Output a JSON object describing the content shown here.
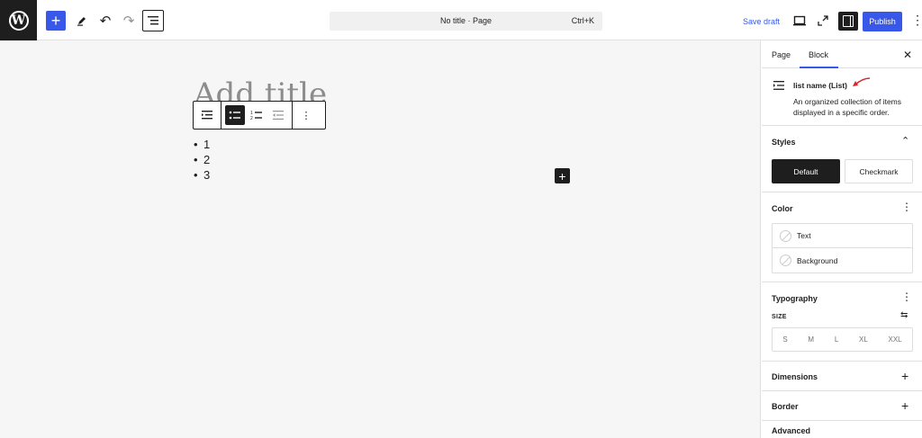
{
  "topbar": {
    "logo_letter": "W",
    "add_icon": "plus-icon",
    "tools_icon": "pencil-icon",
    "undo_icon": "undo-icon",
    "redo_icon": "redo-icon",
    "docview_icon": "list-view-icon",
    "command_title": "No title · Page",
    "command_shortcut": "Ctrl+K",
    "save_draft": "Save draft",
    "preview_icon": "desktop-icon",
    "external_icon": "external-link-icon",
    "settings_icon": "sidebar-toggle-icon",
    "publish": "Publish",
    "more_icon": "kebab-menu-icon"
  },
  "canvas": {
    "title_placeholder": "Add title",
    "list_items": [
      "1",
      "2",
      "3"
    ],
    "inserter_icon": "plus-icon"
  },
  "block_toolbar": {
    "icons": [
      "list-icon",
      "unordered-list-icon",
      "ordered-list-icon",
      "outdent-icon",
      "more-options-icon"
    ],
    "active": "unordered-list-icon"
  },
  "sidebar": {
    "tabs": [
      "Page",
      "Block"
    ],
    "active_tab": "Block",
    "close_icon": "close-icon",
    "block_title": "list name (List)",
    "block_description": "An organized collection of items displayed in a specific order.",
    "styles": {
      "title": "Styles",
      "options": [
        "Default",
        "Checkmark"
      ],
      "selected": "Default"
    },
    "color": {
      "title": "Color",
      "items": [
        "Text",
        "Background"
      ]
    },
    "typography": {
      "title": "Typography",
      "size_label": "SIZE",
      "sizes": [
        "S",
        "M",
        "L",
        "XL",
        "XXL"
      ]
    },
    "dimensions": {
      "title": "Dimensions"
    },
    "border": {
      "title": "Border"
    },
    "partial": {
      "title": "Advanced"
    }
  },
  "colors": {
    "accent": "#3858e9",
    "dark": "#1e1e1e",
    "canvas_bg": "#f6f6f6"
  }
}
